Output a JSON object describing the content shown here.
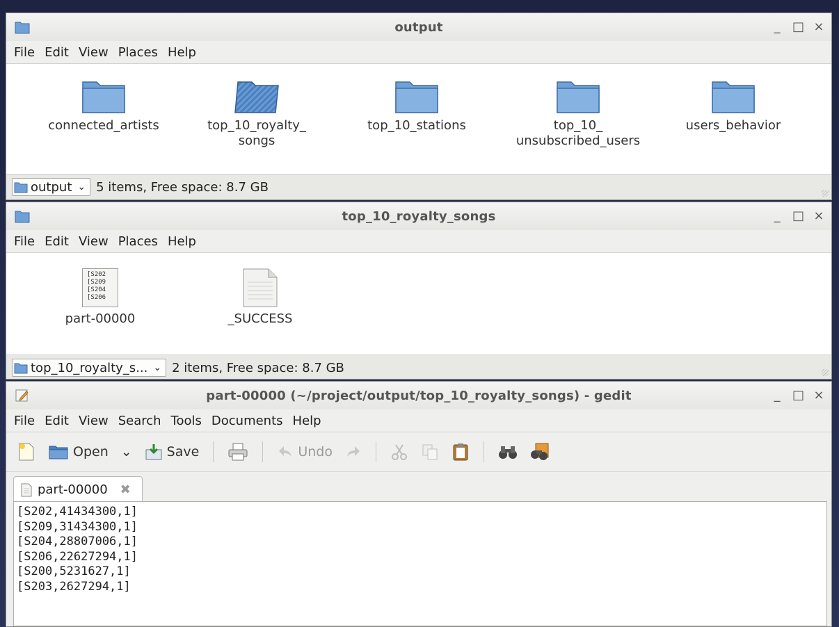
{
  "windows": {
    "output": {
      "title": "output",
      "menu": [
        "File",
        "Edit",
        "View",
        "Places",
        "Help"
      ],
      "items": [
        {
          "label": "connected_artists",
          "icon": "folder-icon"
        },
        {
          "label": "top_10_royalty_\nsongs",
          "icon": "folder-selected-icon"
        },
        {
          "label": "top_10_stations",
          "icon": "folder-icon"
        },
        {
          "label": "top_10_\nunsubscribed_users",
          "icon": "folder-icon"
        },
        {
          "label": "users_behavior",
          "icon": "folder-icon"
        }
      ],
      "location": "output",
      "status": "5 items, Free space: 8.7 GB"
    },
    "royalty": {
      "title": "top_10_royalty_songs",
      "menu": [
        "File",
        "Edit",
        "View",
        "Places",
        "Help"
      ],
      "items": [
        {
          "label": "part-00000",
          "icon": "text-file-icon",
          "preview": [
            "[S202",
            "[S209",
            "[S204",
            "[S206"
          ]
        },
        {
          "label": "_SUCCESS",
          "icon": "blank-file-icon"
        }
      ],
      "location": "top_10_royalty_s...",
      "status": "2 items, Free space: 8.7 GB"
    },
    "gedit": {
      "title": "part-00000 (~/project/output/top_10_royalty_songs) - gedit",
      "menu": [
        "File",
        "Edit",
        "View",
        "Search",
        "Tools",
        "Documents",
        "Help"
      ],
      "toolbar": {
        "open": "Open",
        "save": "Save",
        "undo": "Undo"
      },
      "tab": "part-00000",
      "lines": [
        "[S202,41434300,1]",
        "[S209,31434300,1]",
        "[S204,28807006,1]",
        "[S206,22627294,1]",
        "[S200,5231627,1]",
        "[S203,2627294,1]"
      ]
    }
  },
  "window_controls": {
    "minimize": "_",
    "maximize": "□",
    "close": "×"
  },
  "colors": {
    "folder": "#6fa0d6",
    "folder_dark": "#4a7fbf",
    "titlebar_text": "#555555"
  }
}
